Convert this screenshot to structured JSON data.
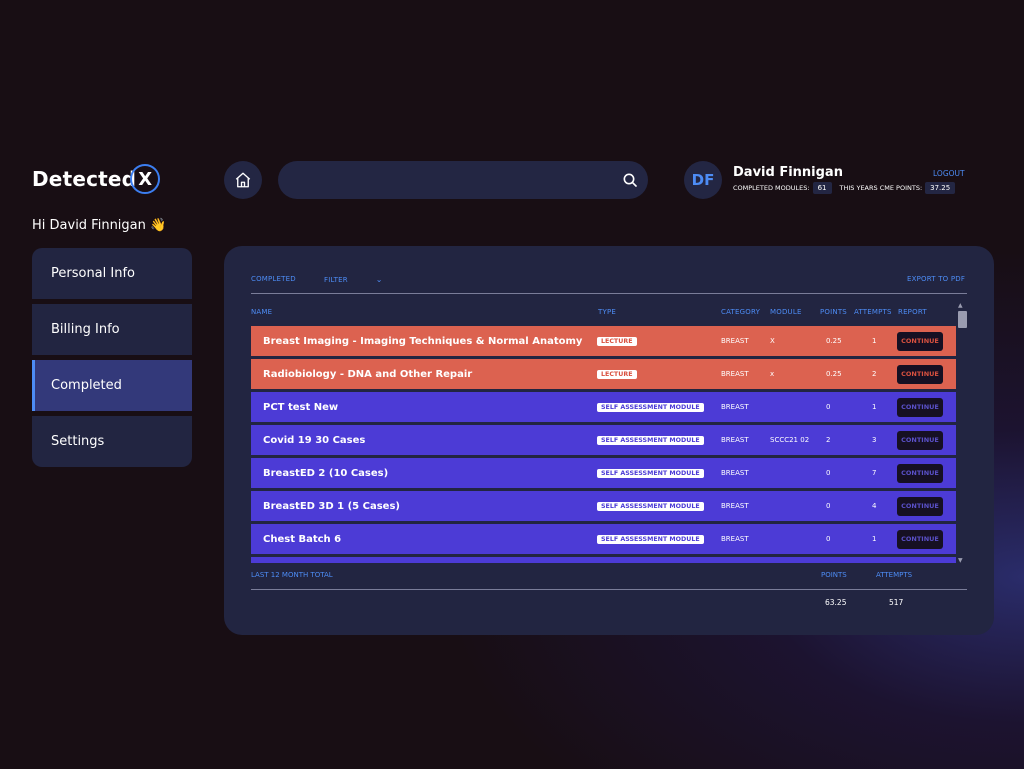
{
  "brand": {
    "name_main": "Detected",
    "name_x": "X"
  },
  "greeting": "Hi David Finnigan 👋",
  "sidebar": {
    "items": [
      {
        "label": "Personal Info"
      },
      {
        "label": "Billing Info"
      },
      {
        "label": "Completed"
      },
      {
        "label": "Settings"
      }
    ]
  },
  "search": {
    "placeholder": ""
  },
  "user": {
    "initials": "DF",
    "name": "David Finnigan",
    "completed_modules_label": "COMPLETED MODULES:",
    "completed_modules": "61",
    "cme_points_label": "THIS YEARS CME POINTS:",
    "cme_points": "37.25",
    "logout": "LOGOUT"
  },
  "panel": {
    "tab": "COMPLETED",
    "filter": "FILTER",
    "export": "EXPORT TO PDF",
    "columns": {
      "name": "NAME",
      "type": "TYPE",
      "category": "CATEGORY",
      "module": "MODULE",
      "points": "POINTS",
      "attempts": "ATTEMPTS",
      "report": "REPORT"
    },
    "rows": [
      {
        "name": "Breast Imaging - Imaging Techniques & Normal Anatomy",
        "type": "LECTURE",
        "category": "BREAST",
        "module": "X",
        "points": "0.25",
        "attempts": "1",
        "action": "CONTINUE"
      },
      {
        "name": "Radiobiology - DNA and Other Repair",
        "type": "LECTURE",
        "category": "BREAST",
        "module": "x",
        "points": "0.25",
        "attempts": "2",
        "action": "CONTINUE"
      },
      {
        "name": "PCT test New",
        "type": "SELF ASSESSMENT MODULE",
        "category": "BREAST",
        "module": "",
        "points": "0",
        "attempts": "1",
        "action": "CONTINUE"
      },
      {
        "name": "Covid 19 30 Cases",
        "type": "SELF ASSESSMENT MODULE",
        "category": "BREAST",
        "module": "SCCC21 02",
        "points": "2",
        "attempts": "3",
        "action": "CONTINUE"
      },
      {
        "name": "BreastED 2 (10 Cases)",
        "type": "SELF ASSESSMENT MODULE",
        "category": "BREAST",
        "module": "",
        "points": "0",
        "attempts": "7",
        "action": "CONTINUE"
      },
      {
        "name": "BreastED 3D 1 (5 Cases)",
        "type": "SELF ASSESSMENT MODULE",
        "category": "BREAST",
        "module": "",
        "points": "0",
        "attempts": "4",
        "action": "CONTINUE"
      },
      {
        "name": "Chest Batch 6",
        "type": "SELF ASSESSMENT MODULE",
        "category": "BREAST",
        "module": "",
        "points": "0",
        "attempts": "1",
        "action": "CONTINUE"
      }
    ],
    "footer": {
      "label": "LAST 12 MONTH TOTAL",
      "points_label": "POINTS",
      "attempts_label": "ATTEMPTS",
      "points_total": "63.25",
      "attempts_total": "517"
    }
  },
  "colors": {
    "lecture_row": "#dc6250",
    "module_row": "#4c3bd6",
    "accent": "#4d8cf5",
    "panel": "#222541"
  },
  "icons": {
    "home": "home-icon",
    "search": "search-icon",
    "scroll_up": "chevron-up-icon",
    "scroll_down": "chevron-down-icon",
    "filter_chevron": "chevron-down-icon"
  }
}
